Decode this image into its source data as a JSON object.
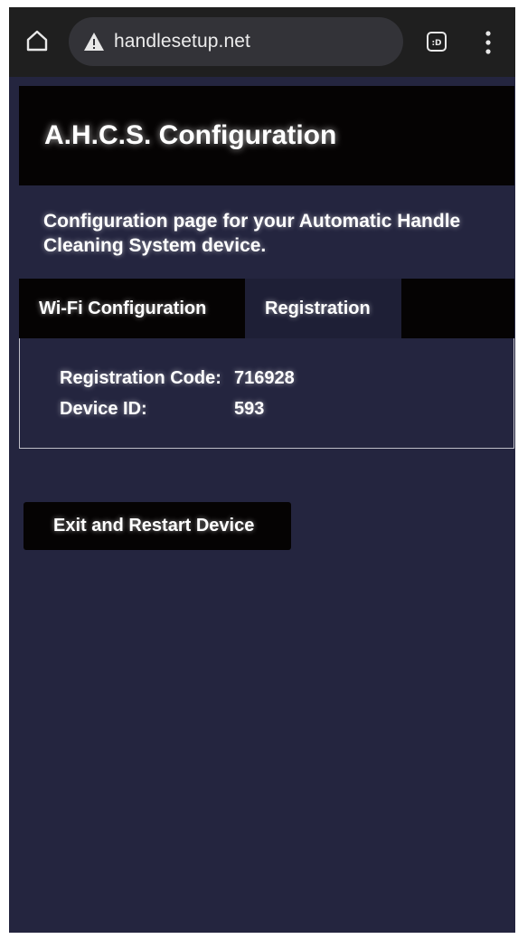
{
  "browser": {
    "url": "handlesetup.net",
    "tabs_badge": ":D",
    "icons": [
      "home-icon",
      "warning-icon",
      "tabs-icon",
      "overflow-menu-icon"
    ]
  },
  "page": {
    "title": "A.H.C.S. Configuration",
    "description": "Configuration page for your Automatic Handle Cleaning System device.",
    "tabs": [
      {
        "label": "Wi-Fi Configuration",
        "active": false
      },
      {
        "label": "Registration",
        "active": true
      }
    ],
    "registration": {
      "code_label": "Registration Code:",
      "code_value": "716928",
      "device_label": "Device ID:",
      "device_value": "593"
    },
    "exit_button": "Exit and Restart Device"
  },
  "colors": {
    "page_background": "#24253f",
    "header_background": "#050303",
    "active_tab_background": "#1e1f36",
    "browser_bar": "#1f1f1f",
    "url_pill": "#333338"
  }
}
